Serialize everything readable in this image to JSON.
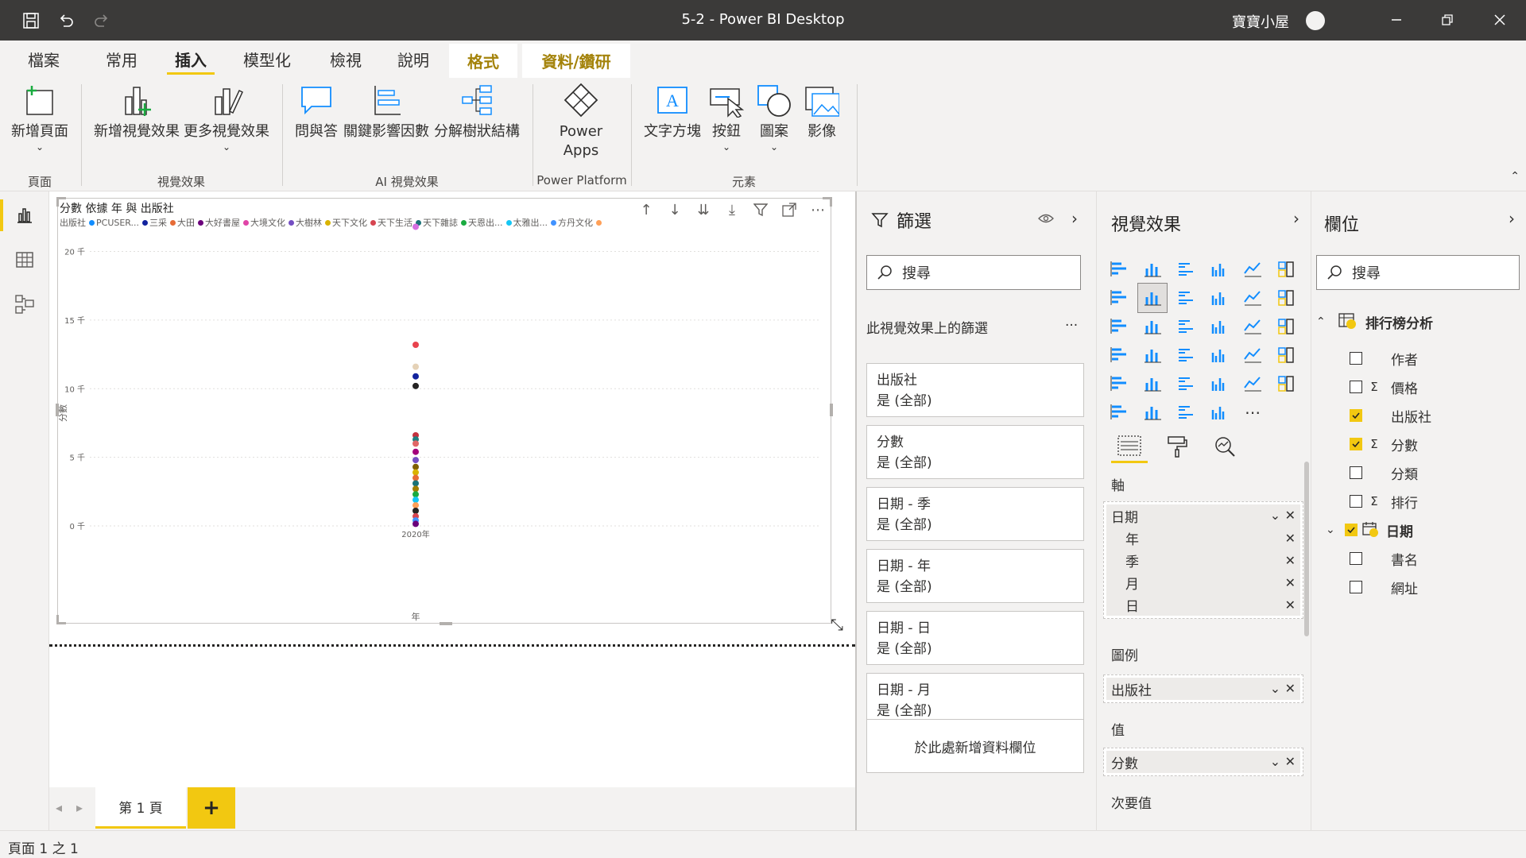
{
  "titlebar": {
    "title": "5-2 - Power BI Desktop",
    "user": "寶寶小屋"
  },
  "tabs": {
    "file": "檔案",
    "home": "常用",
    "insert": "插入",
    "modeling": "模型化",
    "view": "檢視",
    "help": "說明",
    "format": "格式",
    "data_drill": "資料/鑽研"
  },
  "ribbon": {
    "new_page": "新增頁面",
    "new_visual": "新增視覺效果",
    "more_visuals": "更多視覺效果",
    "qa": "問與答",
    "key_influencers": "關鍵影響因數",
    "decomp_tree": "分解樹狀結構",
    "power_apps_1": "Power",
    "power_apps_2": "Apps",
    "text_box": "文字方塊",
    "buttons": "按鈕",
    "shapes": "圖案",
    "image": "影像",
    "group_page": "頁面",
    "group_visuals": "視覺效果",
    "group_ai": "AI 視覺效果",
    "group_power_platform": "Power Platform",
    "group_elements": "元素"
  },
  "chart_data": {
    "type": "scatter",
    "title": "分數 依據 年 與 出版社",
    "legend_title": "出版社",
    "legend": [
      "PCUSER...",
      "三采",
      "大田",
      "大好書屋",
      "大境文化",
      "大樹林",
      "天下文化",
      "天下生活",
      "天下雜誌",
      "天恩出...",
      "太雅出...",
      "方丹文化"
    ],
    "legend_colors": [
      "#118dff",
      "#12239e",
      "#e66c37",
      "#6b007b",
      "#e044a7",
      "#744ec2",
      "#d9b300",
      "#d64550",
      "#197278",
      "#1aab40",
      "#15c6f4",
      "#4092ff",
      "#ffa058"
    ],
    "ylabel": "分數",
    "xlabel": "年",
    "x_categories": [
      "2020年"
    ],
    "y_ticks": [
      "0 千",
      "5 千",
      "10 千",
      "15 千",
      "20 千"
    ],
    "ylim": [
      0,
      22000
    ],
    "points": [
      {
        "x": "2020年",
        "y": 21800,
        "color": "#d56ee0"
      },
      {
        "x": "2020年",
        "y": 13200,
        "color": "#e8434e"
      },
      {
        "x": "2020年",
        "y": 11600,
        "color": "#e5d2b7"
      },
      {
        "x": "2020年",
        "y": 10900,
        "color": "#12239e"
      },
      {
        "x": "2020年",
        "y": 10200,
        "color": "#252423"
      },
      {
        "x": "2020年",
        "y": 6600,
        "color": "#c4313e"
      },
      {
        "x": "2020年",
        "y": 6300,
        "color": "#1f7f7f"
      },
      {
        "x": "2020年",
        "y": 6000,
        "color": "#e06666"
      },
      {
        "x": "2020年",
        "y": 5400,
        "color": "#a3007b"
      },
      {
        "x": "2020年",
        "y": 4800,
        "color": "#744ec2"
      },
      {
        "x": "2020年",
        "y": 4300,
        "color": "#7f6000"
      },
      {
        "x": "2020年",
        "y": 3900,
        "color": "#d9b300"
      },
      {
        "x": "2020年",
        "y": 3500,
        "color": "#e66c37"
      },
      {
        "x": "2020年",
        "y": 3100,
        "color": "#197278"
      },
      {
        "x": "2020年",
        "y": 2700,
        "color": "#9e7d00"
      },
      {
        "x": "2020年",
        "y": 2300,
        "color": "#1aab40"
      },
      {
        "x": "2020年",
        "y": 1900,
        "color": "#15c6f4"
      },
      {
        "x": "2020年",
        "y": 1500,
        "color": "#ffa058"
      },
      {
        "x": "2020年",
        "y": 1100,
        "color": "#252423"
      },
      {
        "x": "2020年",
        "y": 700,
        "color": "#d64550"
      },
      {
        "x": "2020年",
        "y": 400,
        "color": "#4092ff"
      },
      {
        "x": "2020年",
        "y": 150,
        "color": "#6b007b"
      }
    ]
  },
  "page": {
    "tab": "第 1 頁",
    "add": "+"
  },
  "status": {
    "text": "頁面 1 之 1"
  },
  "filters": {
    "title": "篩選",
    "search_placeholder": "搜尋",
    "section": "此視覺效果上的篩選",
    "more": "...",
    "cards": [
      {
        "field": "出版社",
        "value": "是 (全部)"
      },
      {
        "field": "分數",
        "value": "是 (全部)"
      },
      {
        "field": "日期 - 季",
        "value": "是 (全部)"
      },
      {
        "field": "日期 - 年",
        "value": "是 (全部)"
      },
      {
        "field": "日期 - 日",
        "value": "是 (全部)"
      },
      {
        "field": "日期 - 月",
        "value": "是 (全部)"
      }
    ],
    "add_field": "於此處新增資料欄位"
  },
  "viz": {
    "title": "視覺效果",
    "axis_label": "軸",
    "axis_field": "日期",
    "axis_subs": [
      "年",
      "季",
      "月",
      "日"
    ],
    "legend_label": "圖例",
    "legend_field": "出版社",
    "values_label": "值",
    "values_field": "分數",
    "secondary_label": "次要值"
  },
  "fields": {
    "title": "欄位",
    "search_placeholder": "搜尋",
    "table": "排行榜分析",
    "items": [
      {
        "name": "作者",
        "checked": false,
        "sigma": false
      },
      {
        "name": "價格",
        "checked": false,
        "sigma": true
      },
      {
        "name": "出版社",
        "checked": true,
        "sigma": false
      },
      {
        "name": "分數",
        "checked": true,
        "sigma": true
      },
      {
        "name": "分類",
        "checked": false,
        "sigma": false
      },
      {
        "name": "排行",
        "checked": false,
        "sigma": true
      }
    ],
    "date_field": "日期",
    "after_items": [
      {
        "name": "書名",
        "checked": false
      },
      {
        "name": "網址",
        "checked": false
      }
    ]
  }
}
